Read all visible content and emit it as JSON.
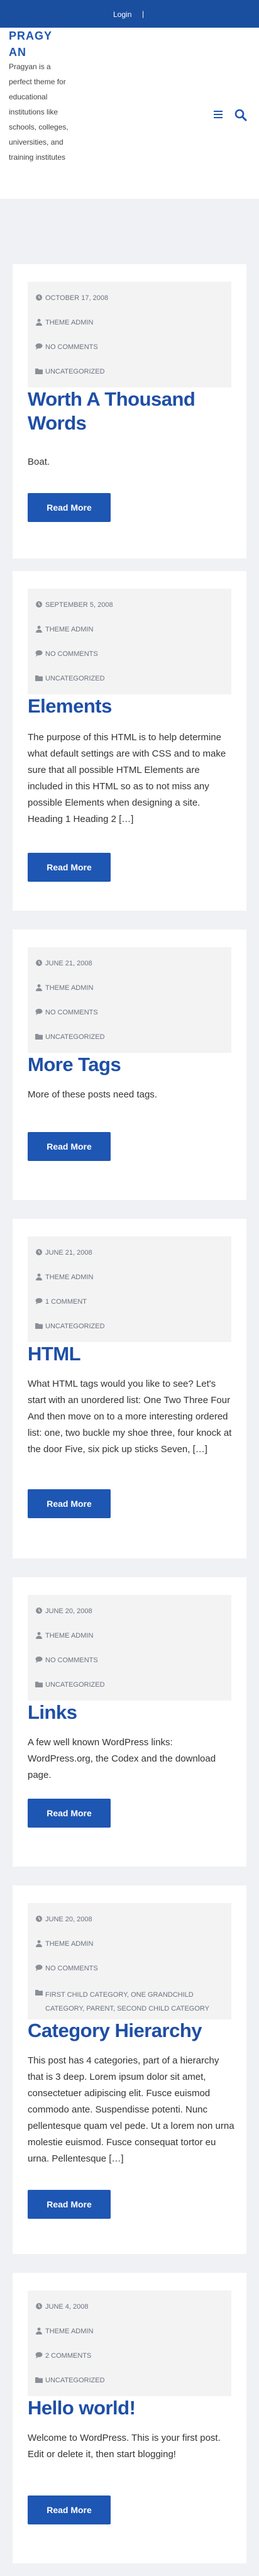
{
  "topbar": {
    "login_label": "Login",
    "separator": "|"
  },
  "site": {
    "title": "PRAGYAN",
    "tagline": "Pragyan is a perfect theme for educational institutions like schools, colleges, universities, and training institutes"
  },
  "read_more_label": "Read More",
  "posts": [
    {
      "date": "OCTOBER 17, 2008",
      "author": "THEME ADMIN",
      "comments": "NO COMMENTS",
      "category": "UNCATEGORIZED",
      "title": "Worth A Thousand Words",
      "excerpt": "Boat."
    },
    {
      "date": "SEPTEMBER 5, 2008",
      "author": "THEME ADMIN",
      "comments": "NO COMMENTS",
      "category": "UNCATEGORIZED",
      "title": "Elements",
      "excerpt": "The purpose of this HTML is to help determine what default settings are with CSS and to make sure that all possible HTML Elements are included in this HTML so as to not miss any possible Elements when designing a site. Heading 1 Heading 2 […]"
    },
    {
      "date": "JUNE 21, 2008",
      "author": "THEME ADMIN",
      "comments": "NO COMMENTS",
      "category": "UNCATEGORIZED",
      "title": "More Tags",
      "excerpt": "More of these posts need tags."
    },
    {
      "date": "JUNE 21, 2008",
      "author": "THEME ADMIN",
      "comments": "1 COMMENT",
      "category": "UNCATEGORIZED",
      "title": "HTML",
      "excerpt": "What HTML tags would you like to see? Let's start with an unordered list: One Two Three Four And then move on to a more interesting ordered list: one, two buckle my shoe three, four knock at the door Five, six pick up sticks Seven, […]"
    },
    {
      "date": "JUNE 20, 2008",
      "author": "THEME ADMIN",
      "comments": "NO COMMENTS",
      "category": "UNCATEGORIZED",
      "title": "Links",
      "excerpt": "A few well known WordPress links: WordPress.org, the Codex and the download page."
    },
    {
      "date": "JUNE 20, 2008",
      "author": "THEME ADMIN",
      "comments": "NO COMMENTS",
      "category": "FIRST CHILD CATEGORY, ONE GRANDCHILD CATEGORY, PARENT, SECOND CHILD CATEGORY",
      "title": "Category Hierarchy",
      "excerpt": "This post has 4 categories, part of a hierarchy that is 3 deep. Lorem ipsum dolor sit amet, consectetuer adipiscing elit. Fusce euismod commodo ante. Suspendisse potenti. Nunc pellentesque quam vel pede. Ut a lorem non urna molestie euismod. Fusce consequat tortor eu urna. Pellentesque […]"
    },
    {
      "date": "JUNE 4, 2008",
      "author": "THEME ADMIN",
      "comments": "2 COMMENTS",
      "category": "UNCATEGORIZED",
      "title": "Hello world!",
      "excerpt": "Welcome to WordPress. This is your first post. Edit or delete it, then start blogging!"
    }
  ]
}
